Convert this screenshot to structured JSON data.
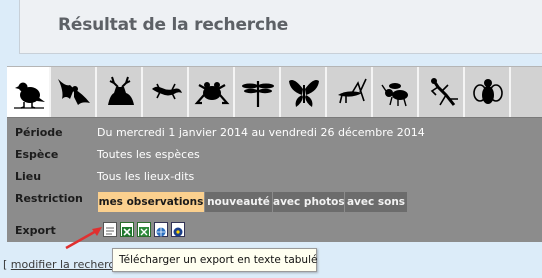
{
  "header": {
    "title": "Résultat de la recherche"
  },
  "tabs": [
    {
      "icon": "bird-icon",
      "active": true
    },
    {
      "icon": "bat-icon",
      "active": false
    },
    {
      "icon": "deer-icon",
      "active": false
    },
    {
      "icon": "lizard-icon",
      "active": false
    },
    {
      "icon": "frog-icon",
      "active": false
    },
    {
      "icon": "dragonfly-icon",
      "active": false
    },
    {
      "icon": "butterfly-icon",
      "active": false
    },
    {
      "icon": "grasshopper-icon",
      "active": false
    },
    {
      "icon": "bee-icon",
      "active": false
    },
    {
      "icon": "mantis-icon",
      "active": false
    },
    {
      "icon": "fly-icon",
      "active": false
    }
  ],
  "summary": {
    "periode_label": "Période",
    "periode_value": "Du mercredi 1 janvier 2014 au vendredi 26 décembre 2014",
    "espece_label": "Espèce",
    "espece_value": "Toutes les espèces",
    "lieu_label": "Lieu",
    "lieu_value": "Tous les lieux-dits",
    "restriction_label": "Restriction",
    "export_label": "Export"
  },
  "restrictions": [
    {
      "label": "mes observations",
      "active": true
    },
    {
      "label": "nouveauté",
      "active": false
    },
    {
      "label": "avec photos",
      "active": false
    },
    {
      "label": "avec sons",
      "active": false
    }
  ],
  "export_icons": [
    "text-file-icon",
    "excel-xls-icon",
    "excel-xlsx-icon",
    "kml-globe-icon",
    "gps-file-icon"
  ],
  "footer": {
    "modify_prefix": "[ ",
    "modify_link": "modifier la recherche"
  },
  "tooltip": {
    "text": "Télécharger un export en texte tabulé"
  },
  "colors": {
    "background": "#dcecf9",
    "panel": "#8c8c8c",
    "active_button": "#fbd08e",
    "arrow": "#e03030"
  }
}
